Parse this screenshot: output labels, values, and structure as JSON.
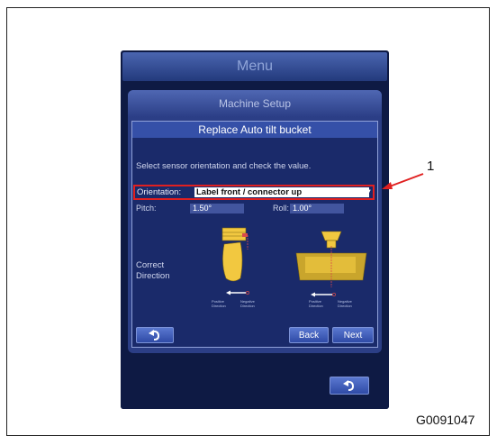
{
  "menu": {
    "title": "Menu"
  },
  "setup": {
    "title": "Machine Setup"
  },
  "dialog": {
    "title": "Replace Auto tilt bucket",
    "instruction": "Select sensor orientation and check the value.",
    "orientation": {
      "label": "Orientation:",
      "value": "Label front / connector up"
    },
    "pitch": {
      "label": "Pitch:",
      "value": "1.50°"
    },
    "roll": {
      "label": "Roll:",
      "value": "1.00°"
    },
    "correct_direction": "Correct\nDirection",
    "graphic_left": {
      "positive": "Positive\nDirection",
      "negative": "Negative\nDirection"
    },
    "graphic_right": {
      "positive": "Positive\nDirection",
      "negative": "Negative\nDirection"
    }
  },
  "buttons": {
    "back": "Back",
    "next": "Next"
  },
  "callout": "1",
  "figure_code": "G0091047",
  "colors": {
    "highlight": "#e02020",
    "panel": "#2b3e86",
    "title_bar": "#3550a8"
  }
}
